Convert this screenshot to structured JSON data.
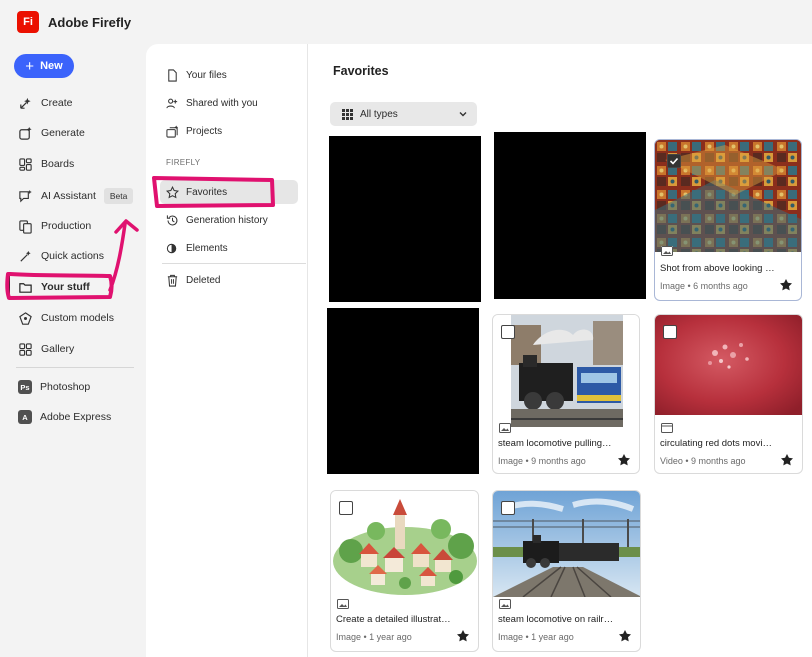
{
  "app": {
    "logo_text": "Fi",
    "title": "Adobe Firefly",
    "brand_color": "#eb1000",
    "accent_color": "#3b63fb"
  },
  "rail": {
    "new_label": "New",
    "items": [
      {
        "label": "Create",
        "icon": "create-icon"
      },
      {
        "label": "Generate",
        "icon": "generate-icon"
      },
      {
        "label": "Boards",
        "icon": "boards-icon"
      },
      {
        "label": "AI Assistant",
        "icon": "ai-assistant-icon",
        "badge": "Beta"
      },
      {
        "label": "Production",
        "icon": "production-icon"
      },
      {
        "label": "Quick actions",
        "icon": "quick-actions-icon"
      },
      {
        "label": "Your stuff",
        "icon": "folder-icon",
        "active": true
      },
      {
        "label": "Custom models",
        "icon": "custom-models-icon"
      },
      {
        "label": "Gallery",
        "icon": "gallery-icon"
      }
    ],
    "apps": [
      {
        "badge": "Ps",
        "label": "Photoshop"
      },
      {
        "badge": "A",
        "label": "Adobe Express"
      }
    ]
  },
  "subnav": {
    "items": [
      {
        "label": "Your files",
        "icon": "file-icon"
      },
      {
        "label": "Shared with you",
        "icon": "shared-icon"
      },
      {
        "label": "Projects",
        "icon": "projects-icon"
      }
    ],
    "section_heading": "FIREFLY",
    "firefly_items": [
      {
        "label": "Favorites",
        "icon": "star-icon",
        "selected": true
      },
      {
        "label": "Generation history",
        "icon": "history-icon"
      },
      {
        "label": "Elements",
        "icon": "elements-icon"
      }
    ],
    "deleted_label": "Deleted"
  },
  "content": {
    "title": "Favorites",
    "filter_label": "All types",
    "cards": [
      {
        "caption": "Shot from above looking do...",
        "type": "Image",
        "age": "6 months ago",
        "checked": true,
        "favorite": true
      },
      {
        "caption": "steam locomotive pulling pa...",
        "type": "Image",
        "age": "9 months ago",
        "checked": false,
        "favorite": true
      },
      {
        "caption": "circulating red dots moving a...",
        "type": "Video",
        "age": "9 months ago",
        "checked": false,
        "favorite": true
      },
      {
        "caption": "Create a detailed illustration ...",
        "type": "Image",
        "age": "1 year ago",
        "checked": false,
        "favorite": true
      },
      {
        "caption": "steam locomotive on railroa...",
        "type": "Image",
        "age": "1 year ago",
        "checked": false,
        "favorite": true
      }
    ]
  },
  "annotation_color": "#e0116f"
}
